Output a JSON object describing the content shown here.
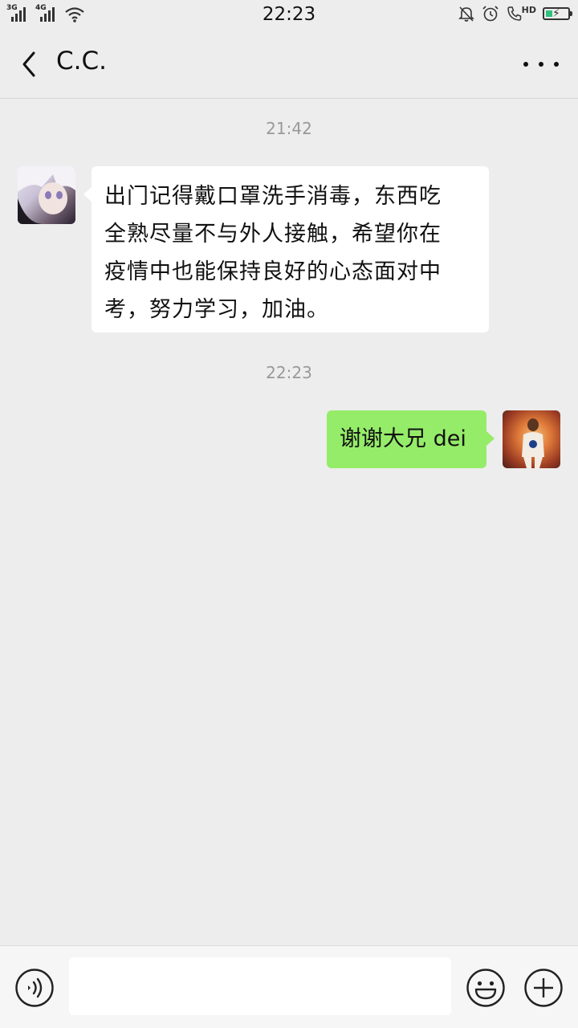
{
  "status_bar": {
    "time": "22:23",
    "network_1": "3G",
    "network_2": "4G",
    "call_label": "HD",
    "icons": [
      "signal-icon",
      "wifi-icon",
      "mute-bell-icon",
      "alarm-icon",
      "hd-call-icon",
      "battery-charging-icon"
    ]
  },
  "header": {
    "title": "C.C.",
    "back_icon": "chevron-left-icon",
    "more_icon": "more-dots-icon"
  },
  "messages": [
    {
      "timestamp": "21:42",
      "sender": "contact",
      "lines": [
        "出门记得戴口罩洗手消毒，东西吃",
        "全熟尽量不与外人接触，希望你在",
        "疫情中也能保持良好的心态面对中",
        "考，努力学习，加油。"
      ]
    },
    {
      "timestamp": "22:23",
      "sender": "me",
      "text": "谢谢大兄 dei"
    }
  ],
  "input_bar": {
    "value": "",
    "icons": [
      "voice-icon",
      "emoji-icon",
      "plus-icon"
    ]
  },
  "colors": {
    "background": "#ededed",
    "incoming_bubble": "#ffffff",
    "outgoing_bubble": "#95ec69",
    "timestamp": "#999999",
    "battery_fill": "#2ec27e"
  }
}
